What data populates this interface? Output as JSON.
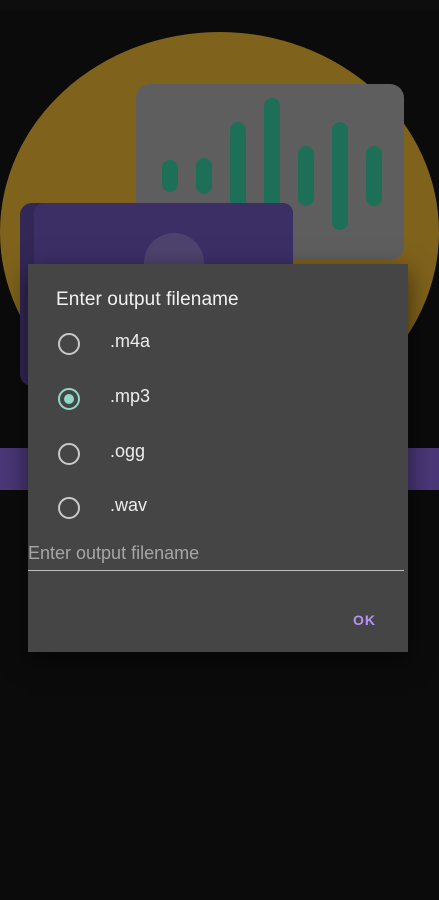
{
  "dialog": {
    "title": "Enter output filename",
    "format_options": [
      {
        "label": ".m4a",
        "checked": false
      },
      {
        "label": ".mp3",
        "checked": true
      },
      {
        "label": ".ogg",
        "checked": false
      },
      {
        "label": ".wav",
        "checked": false
      }
    ],
    "filename_input": {
      "value": "",
      "placeholder": "Enter output filename"
    },
    "ok_label": "OK"
  },
  "illustration": {
    "circle_color": "#8a6a1d",
    "wave_card_color": "#5e5e5e",
    "wave_bar_color": "#1e6f58",
    "video_card_color": "#3c2f66",
    "stripe_color": "#4a3778",
    "icons": [
      "audio-waveform-icon",
      "video-play-icon"
    ]
  },
  "colors": {
    "radio_checked": "#8fd8c8",
    "ok_accent": "#b593f2",
    "dialog_background": "#454545"
  }
}
